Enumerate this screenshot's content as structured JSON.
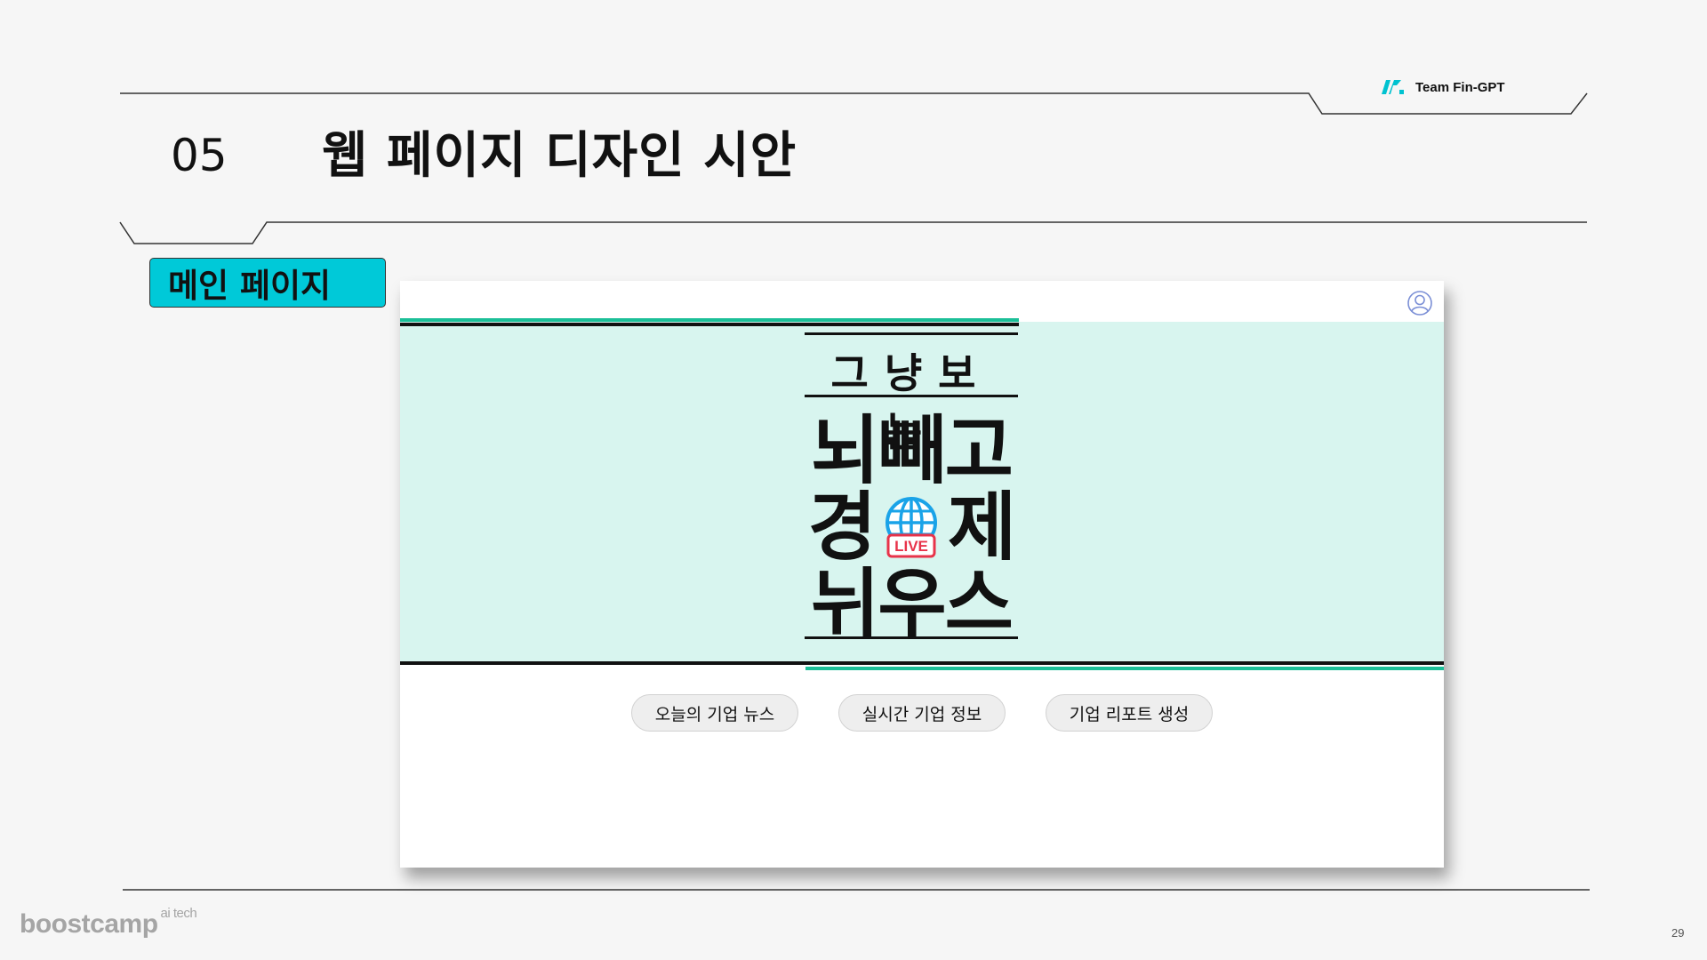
{
  "header": {
    "team_label": "Team Fin-GPT",
    "section_number": "05",
    "section_title": "웹 페이지 디자인 시안"
  },
  "tag": {
    "label": "메인 페이지"
  },
  "mockup": {
    "logo": {
      "tagline": "그냥보는",
      "line1": "뇌빼고",
      "line2_left": "경",
      "line2_right": "제",
      "line3": "뉘우스",
      "badge": "LIVE"
    },
    "buttons": [
      {
        "label": "오늘의 기업 뉴스"
      },
      {
        "label": "실시간 기업 정보"
      },
      {
        "label": "기업 리포트 생성"
      }
    ],
    "colors": {
      "hero_bg": "#d8f5ef",
      "accent_teal": "#1bbf98",
      "badge_red": "#e8334a",
      "globe_blue": "#1aa3e8"
    }
  },
  "footer": {
    "brand": "boostcamp",
    "brand_sup": "ai tech",
    "page_number": "29"
  },
  "colors": {
    "tag_bg": "#00c9d8",
    "page_bg": "#f6f6f6"
  }
}
